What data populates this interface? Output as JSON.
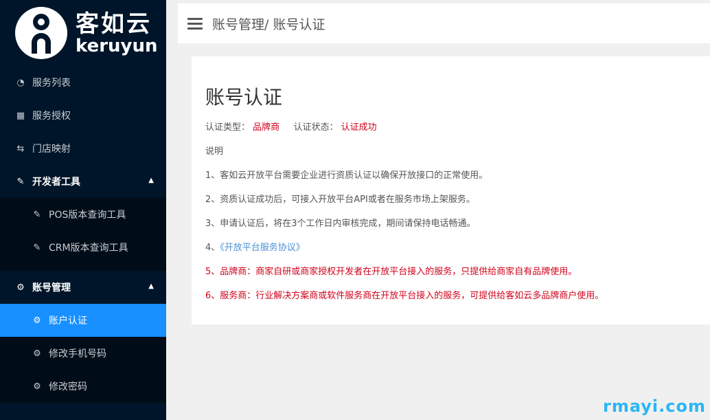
{
  "logo": {
    "cn": "客如云",
    "en": "keruyun"
  },
  "sidebar": {
    "items": [
      {
        "label": "服务列表",
        "icon": "gauge-icon"
      },
      {
        "label": "服务授权",
        "icon": "grid-icon"
      },
      {
        "label": "门店映射",
        "icon": "swap-icon"
      }
    ],
    "devtools": {
      "label": "开发者工具",
      "children": [
        {
          "label": "POS版本查询工具"
        },
        {
          "label": "CRM版本查询工具"
        }
      ]
    },
    "account": {
      "label": "账号管理",
      "children": [
        {
          "label": "账户认证"
        },
        {
          "label": "修改手机号码"
        },
        {
          "label": "修改密码"
        }
      ]
    }
  },
  "header": {
    "breadcrumb": "账号管理/ 账号认证"
  },
  "main": {
    "title": "账号认证",
    "cert_type_label": "认证类型：",
    "cert_type_value": "品牌商",
    "cert_status_label": "认证状态：",
    "cert_status_value": "认证成功",
    "intro": "说明",
    "lines": {
      "l1": "1、客如云开放平台需要企业进行资质认证以确保开放接口的正常使用。",
      "l2": "2、资质认证成功后，可接入开放平台API或者在服务市场上架服务。",
      "l3": "3、申请认证后，将在3个工作日内审核完成，期间请保持电话畅通。",
      "l4_prefix": "4、",
      "l4_link": "《开放平台服务协议》",
      "l5": "5、品牌商：商家自研或商家授权开发者在开放平台接入的服务，只提供给商家自有品牌使用。",
      "l6": "6、服务商：行业解决方案商或软件服务商在开放平台接入的服务，可提供给客如云多品牌商户使用。"
    }
  },
  "watermark": "rmayi.com",
  "colors": {
    "sidebar_bg": "#001529",
    "active": "#1890ff",
    "danger": "#d0021b",
    "link": "#4a90d9"
  }
}
